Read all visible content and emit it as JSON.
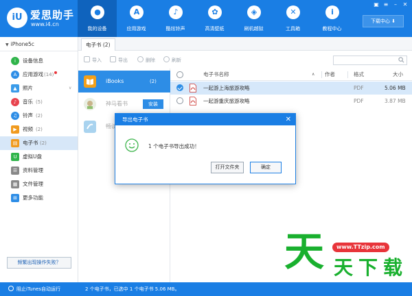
{
  "app": {
    "name": "爱思助手",
    "url": "www.i4.cn",
    "download_center": "下载中心",
    "download_icon": "download-arrow"
  },
  "nav": [
    {
      "label": "我的设备",
      "icon": "apple-icon",
      "glyph": ""
    },
    {
      "label": "应用游戏",
      "icon": "appstore-icon",
      "glyph": "A"
    },
    {
      "label": "酷炫铃声",
      "icon": "bell-icon",
      "glyph": "🔔"
    },
    {
      "label": "高清壁纸",
      "icon": "flower-icon",
      "glyph": "✿"
    },
    {
      "label": "刷机越狱",
      "icon": "dropbox-icon",
      "glyph": "◈"
    },
    {
      "label": "工具箱",
      "icon": "tools-icon",
      "glyph": "✕"
    },
    {
      "label": "教程中心",
      "icon": "info-icon",
      "glyph": "i"
    }
  ],
  "device": {
    "name": "iPhone5c"
  },
  "sidebar": {
    "items": [
      {
        "label": "设备信息",
        "count": "",
        "icon": "info-icon",
        "color": "#2fb44a"
      },
      {
        "label": "应用游戏",
        "count": "(14)",
        "icon": "apps-icon",
        "color": "#2d8de6",
        "badge": true
      },
      {
        "label": "照片",
        "count": "",
        "icon": "photo-icon",
        "color": "#3a9be9",
        "chevron": true
      },
      {
        "label": "音乐",
        "count": "(5)",
        "icon": "music-icon",
        "color": "#e8434e"
      },
      {
        "label": "铃声",
        "count": "(2)",
        "icon": "bell-icon",
        "color": "#2d8de6"
      },
      {
        "label": "视频",
        "count": "(2)",
        "icon": "video-icon",
        "color": "#f09a1e"
      },
      {
        "label": "电子书",
        "count": "(2)",
        "icon": "book-icon",
        "color": "#f09a1e",
        "active": true
      },
      {
        "label": "虚拟U盘",
        "count": "",
        "icon": "usb-icon",
        "color": "#2fb44a"
      },
      {
        "label": "资料管理",
        "count": "",
        "icon": "contacts-icon",
        "color": "#888888"
      },
      {
        "label": "文件管理",
        "count": "",
        "icon": "file-icon",
        "color": "#888888"
      },
      {
        "label": "更多功能",
        "count": "",
        "icon": "more-icon",
        "color": "#2d8de6"
      }
    ],
    "trouble_button": "频繁出现操作失败？"
  },
  "tab": {
    "label": "电子书 (2)"
  },
  "toolbar": {
    "import": "导入",
    "export": "导出",
    "delete": "删除",
    "refresh": "刷新",
    "search_placeholder": ""
  },
  "categories": [
    {
      "name": "iBooks",
      "count": "(2)",
      "icon": "ibooks-icon",
      "active": true
    },
    {
      "name": "神马看书",
      "count": "",
      "icon": "reader-icon",
      "install": "安装"
    },
    {
      "name": "畅读",
      "count": "",
      "icon": "changdu-icon"
    }
  ],
  "table": {
    "columns": {
      "name": "电子书名称",
      "author": "作者",
      "format": "格式",
      "size": "大小"
    },
    "rows": [
      {
        "name": "一起游上海旅游攻略",
        "author": "",
        "format": "PDF",
        "size": "5.06 MB",
        "selected": true
      },
      {
        "name": "一起游重庆旅游攻略",
        "author": "",
        "format": "PDF",
        "size": "3.87 MB",
        "selected": false
      }
    ]
  },
  "status": {
    "itunes": "阻止iTunes自动运行",
    "summary": "2 个电子书，已选中 1 个电子书 5.06 MB。"
  },
  "modal": {
    "title": "导出电子书",
    "message": "1 个电子书导出成功！",
    "open_folder": "打开文件夹",
    "confirm": "确定"
  },
  "watermark": {
    "url": "www.TTzip.com",
    "big": "天",
    "chars": [
      "天",
      "下",
      "载"
    ]
  },
  "colors": {
    "accent": "#1a7ee4",
    "selected_row": "#d6e8fa",
    "watermark_green": "#19b02e",
    "watermark_red": "#e8343a"
  }
}
